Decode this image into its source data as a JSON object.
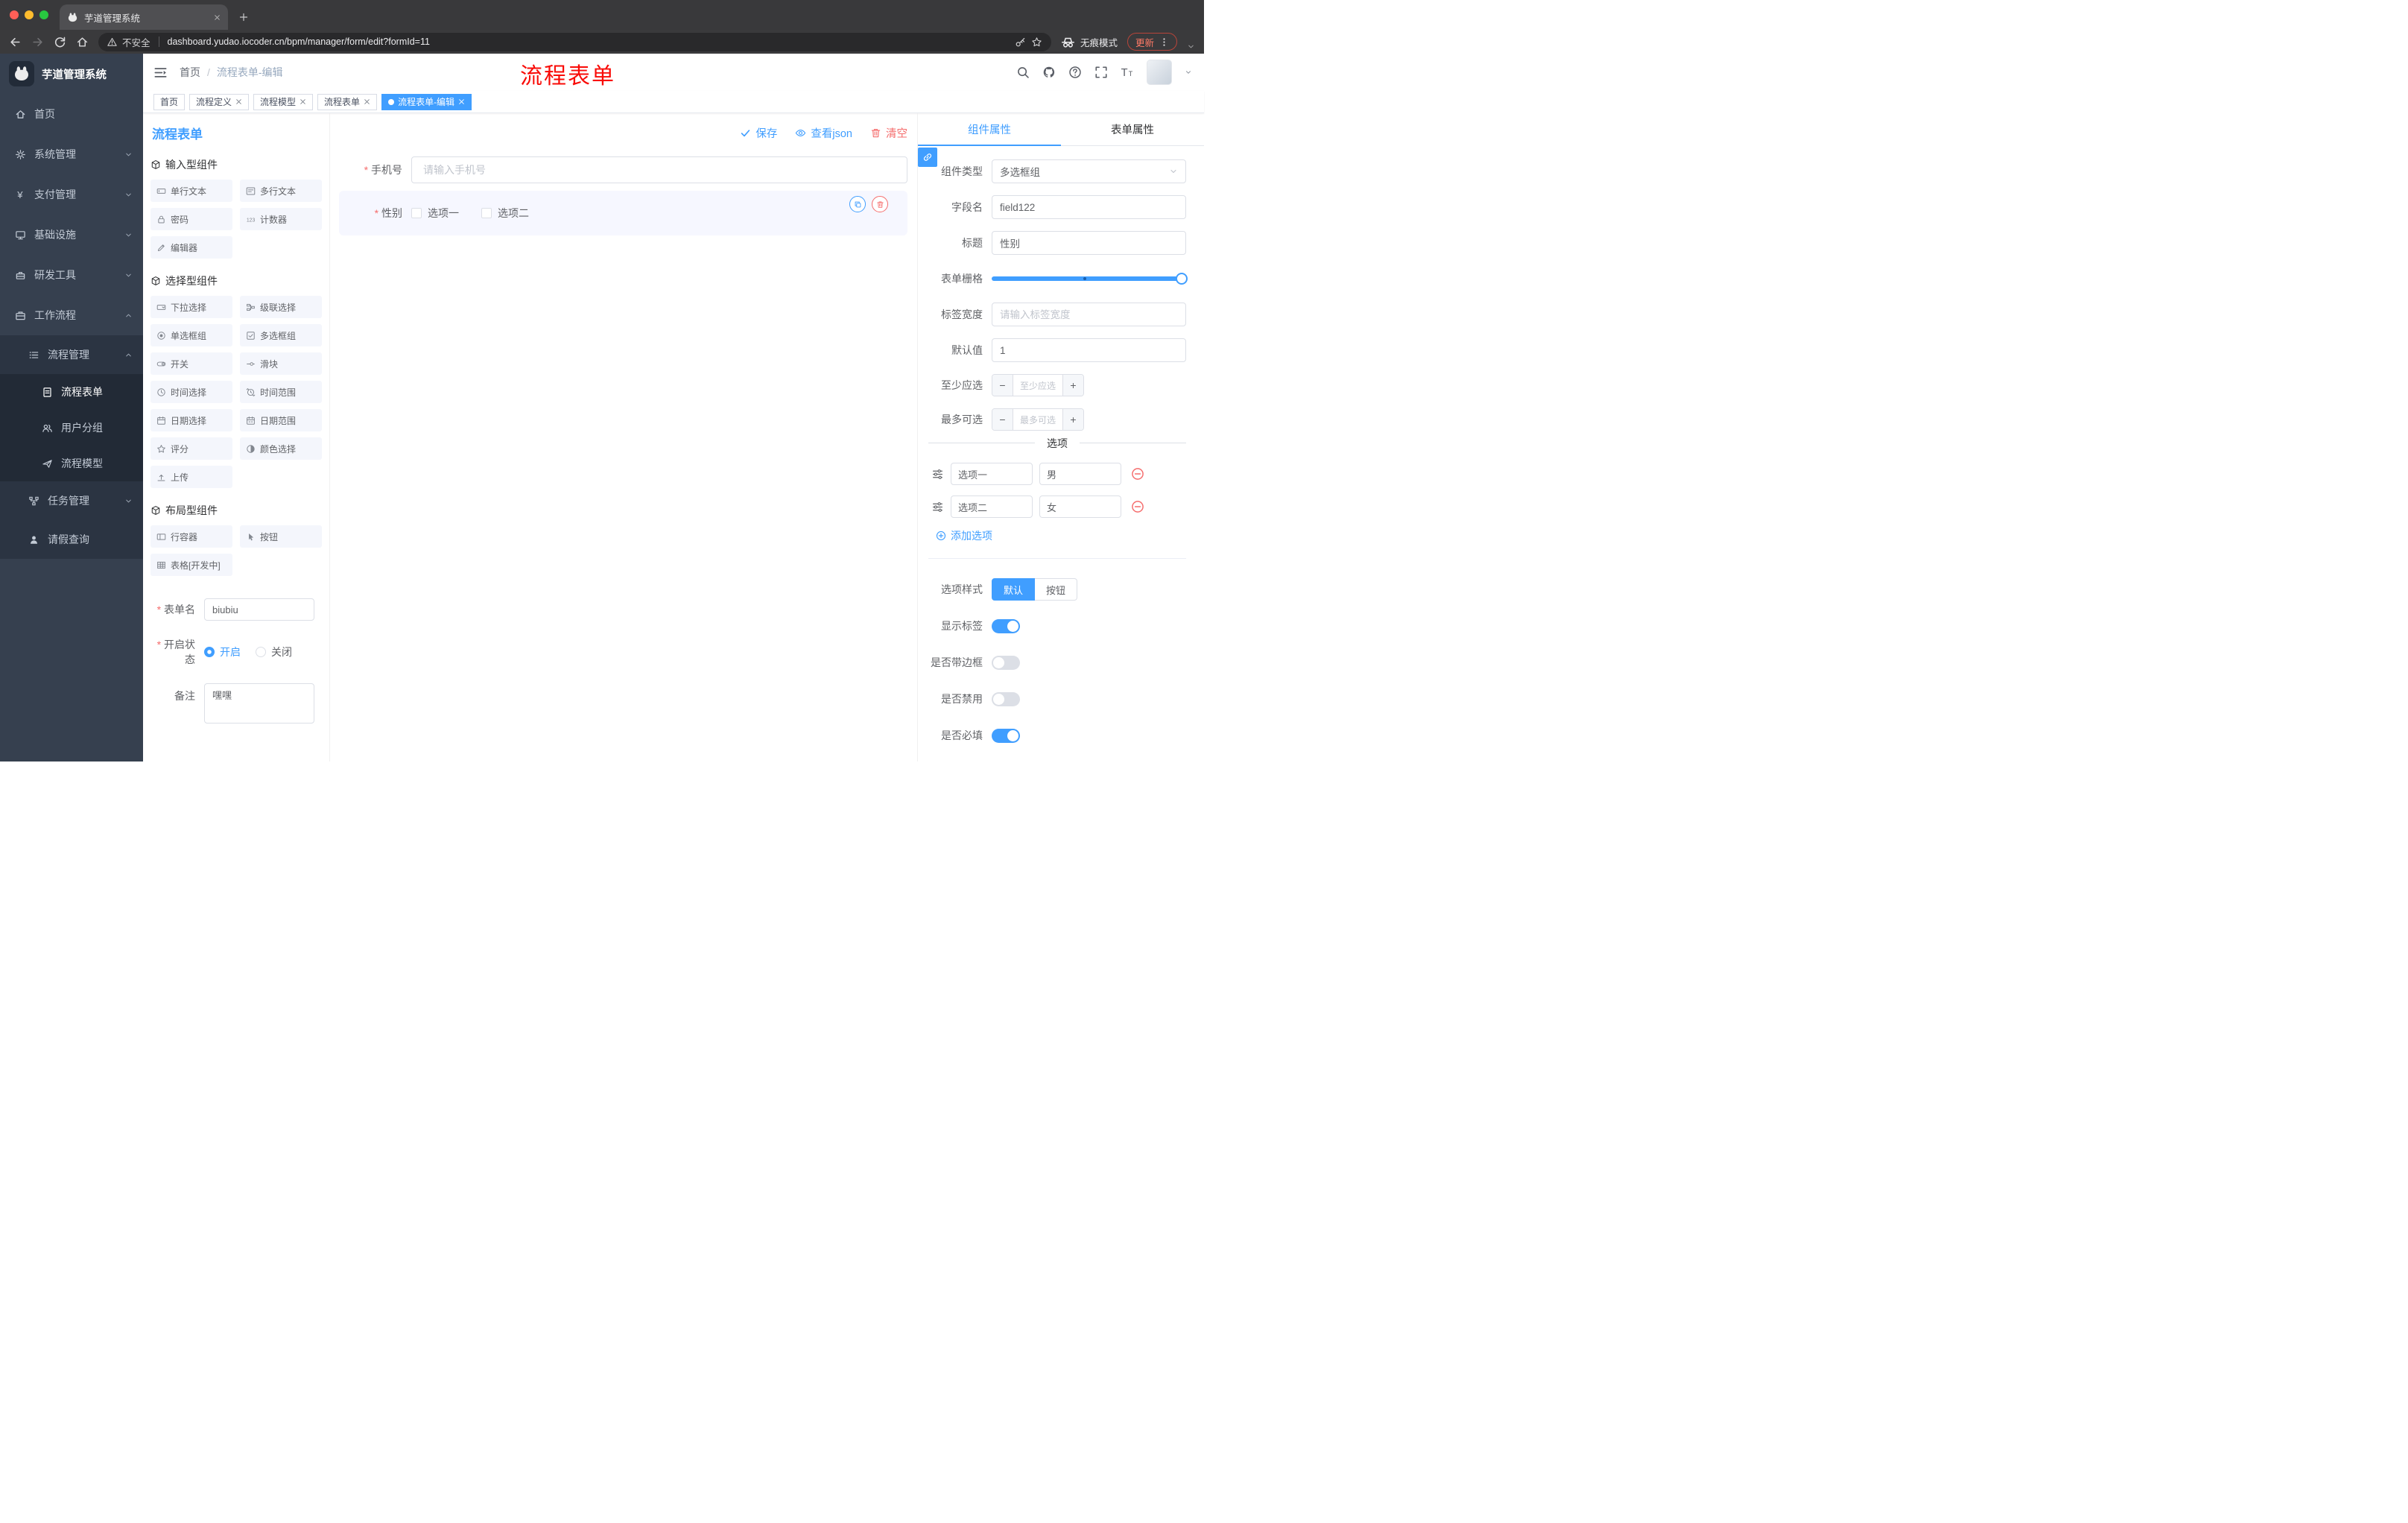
{
  "browser": {
    "tab": {
      "title": "芋道管理系统"
    },
    "address": {
      "security": "不安全",
      "url": "dashboard.yudao.iocoder.cn/bpm/manager/form/edit?formId=11"
    },
    "incognito": "无痕模式",
    "update": "更新"
  },
  "sidebar": {
    "logo": "芋道管理系统",
    "items": [
      {
        "label": "首页"
      },
      {
        "label": "系统管理"
      },
      {
        "label": "支付管理"
      },
      {
        "label": "基础设施"
      },
      {
        "label": "研发工具"
      },
      {
        "label": "工作流程"
      },
      {
        "label": "流程管理"
      },
      {
        "label": "流程表单"
      },
      {
        "label": "用户分组"
      },
      {
        "label": "流程模型"
      },
      {
        "label": "任务管理"
      },
      {
        "label": "请假查询"
      }
    ]
  },
  "header": {
    "breadcrumb": {
      "home": "首页",
      "current": "流程表单-编辑"
    },
    "annotation": "流程表单"
  },
  "tags": [
    {
      "label": "首页"
    },
    {
      "label": "流程定义"
    },
    {
      "label": "流程模型"
    },
    {
      "label": "流程表单"
    },
    {
      "label": "流程表单-编辑"
    }
  ],
  "designer": {
    "panel_title": "流程表单",
    "toolbar": {
      "save": "保存",
      "view_json": "查看json",
      "clear": "清空"
    },
    "groups": [
      {
        "title": "输入型组件",
        "items": [
          "单行文本",
          "多行文本",
          "密码",
          "计数器",
          "编辑器"
        ]
      },
      {
        "title": "选择型组件",
        "items": [
          "下拉选择",
          "级联选择",
          "单选框组",
          "多选框组",
          "开关",
          "滑块",
          "时间选择",
          "时间范围",
          "日期选择",
          "日期范围",
          "评分",
          "颜色选择",
          "上传"
        ]
      },
      {
        "title": "布局型组件",
        "items": [
          "行容器",
          "按钮",
          "表格[开发中]"
        ]
      }
    ],
    "meta": {
      "name_label": "表单名",
      "name_value": "biubiu",
      "status_label": "开启状态",
      "status_on": "开启",
      "status_off": "关闭",
      "remark_label": "备注",
      "remark_value": "嘿嘿"
    },
    "canvas": {
      "phone_label": "手机号",
      "phone_placeholder": "请输入手机号",
      "gender_label": "性别",
      "gender_options": [
        "选项一",
        "选项二"
      ]
    }
  },
  "props": {
    "tabs": {
      "component": "组件属性",
      "form": "表单属性"
    },
    "type_label": "组件类型",
    "type_value": "多选框组",
    "field_label": "字段名",
    "field_value": "field122",
    "title_label": "标题",
    "title_value": "性别",
    "grid_label": "表单栅格",
    "width_label": "标签宽度",
    "width_placeholder": "请输入标签宽度",
    "default_label": "默认值",
    "default_value": "1",
    "min_label": "至少应选",
    "min_placeholder": "至少应选",
    "max_label": "最多可选",
    "max_placeholder": "最多可选",
    "options_title": "选项",
    "options": [
      {
        "label": "选项一",
        "value": "男"
      },
      {
        "label": "选项二",
        "value": "女"
      }
    ],
    "add_option": "添加选项",
    "style_label": "选项样式",
    "style_default": "默认",
    "style_button": "按钮",
    "toggles": [
      {
        "label": "显示标签",
        "on": true
      },
      {
        "label": "是否带边框",
        "on": false
      },
      {
        "label": "是否禁用",
        "on": false
      },
      {
        "label": "是否必填",
        "on": true
      }
    ]
  },
  "colors": {
    "accent": "#409eff",
    "danger": "#f56c6c",
    "annotation": "#f90b07"
  }
}
